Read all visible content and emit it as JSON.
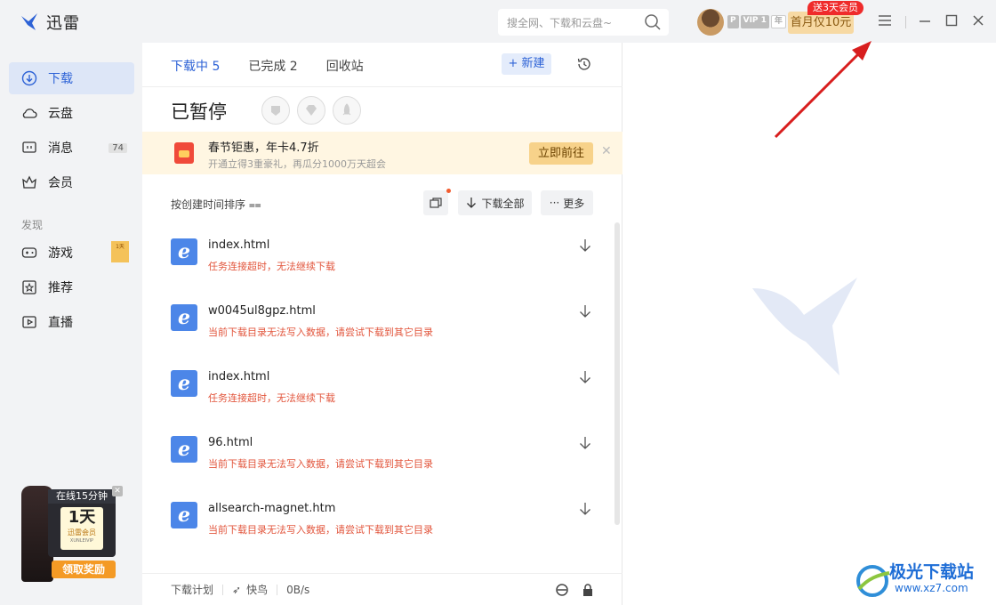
{
  "app": {
    "name": "迅雷"
  },
  "search": {
    "placeholder": "搜全网、下载和云盘~"
  },
  "account": {
    "vip_badges": [
      "P",
      "VIP 1",
      "年"
    ],
    "promo_button": "首月仅10元",
    "promo_tag": "送3天会员"
  },
  "sidebar": {
    "items": [
      {
        "label": "下载",
        "icon": "download-icon",
        "active": true
      },
      {
        "label": "云盘",
        "icon": "cloud-icon"
      },
      {
        "label": "消息",
        "icon": "message-icon",
        "count": "74"
      },
      {
        "label": "会员",
        "icon": "crown-icon"
      }
    ],
    "section_label": "发现",
    "discover": [
      {
        "label": "游戏",
        "icon": "gamepad-icon",
        "badge": "1天"
      },
      {
        "label": "推荐",
        "icon": "star-icon"
      },
      {
        "label": "直播",
        "icon": "live-icon"
      }
    ],
    "ad": {
      "top": "在线15分钟",
      "big": "1天",
      "member": "迅雷会员",
      "eng": "XUNLEIVIP",
      "button": "领取奖励"
    }
  },
  "panel": {
    "tabs": [
      {
        "label": "下载中 5",
        "active": true
      },
      {
        "label": "已完成 2"
      },
      {
        "label": "回收站"
      }
    ],
    "new_button": "+ 新建",
    "status_title": "已暂停",
    "banner": {
      "title": "春节钜惠，年卡4.7折",
      "subtitle": "开通立得3重豪礼，再瓜分1000万天超会",
      "button": "立即前往"
    },
    "sort_label": "按创建时间排序",
    "download_all": "下载全部",
    "more": "更多",
    "items": [
      {
        "name": "index.html",
        "error": "任务连接超时，无法继续下载"
      },
      {
        "name": "w0045ul8gpz.html",
        "error": "当前下载目录无法写入数据，请尝试下载到其它目录"
      },
      {
        "name": "index.html",
        "error": "任务连接超时，无法继续下载"
      },
      {
        "name": "96.html",
        "error": "当前下载目录无法写入数据，请尝试下载到其它目录"
      },
      {
        "name": "allsearch-magnet.htm",
        "error": "当前下载目录无法写入数据，请尝试下载到其它目录"
      }
    ],
    "footer": {
      "plan": "下载计划",
      "speed_mode": "快鸟",
      "speed": "0B/s"
    }
  },
  "watermark": {
    "text": "极光下载站",
    "url": "www.xz7.com"
  },
  "colors": {
    "accent": "#2d62d6",
    "error": "#e2553c",
    "promo": "#f7d9a3"
  }
}
